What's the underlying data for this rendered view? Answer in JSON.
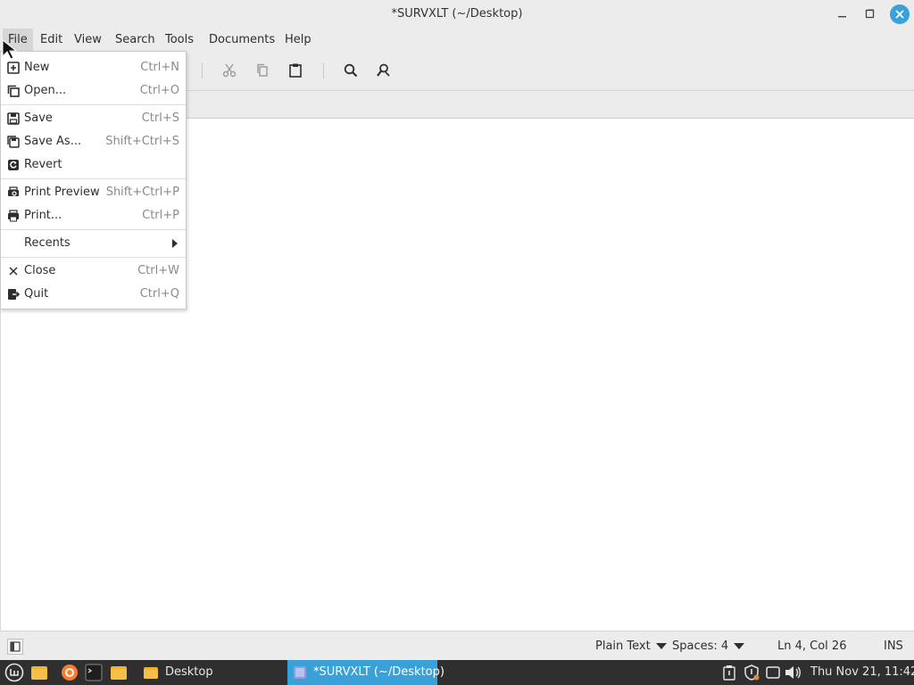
{
  "window": {
    "title": "*SURVXLT (~/Desktop)"
  },
  "menubar": {
    "items": [
      "File",
      "Edit",
      "View",
      "Search",
      "Tools",
      "Documents",
      "Help"
    ],
    "active": "File"
  },
  "toolbar": {
    "icons": [
      "cut-icon",
      "copy-icon",
      "paste-icon",
      "search-icon",
      "find-replace-icon"
    ]
  },
  "file_menu": {
    "items": [
      {
        "label": "New",
        "shortcut": "Ctrl+N",
        "icon": "new-document-icon"
      },
      {
        "label": "Open...",
        "shortcut": "Ctrl+O",
        "icon": "open-icon"
      },
      {
        "label": "Save",
        "shortcut": "Ctrl+S",
        "icon": "save-icon"
      },
      {
        "label": "Save As...",
        "shortcut": "Shift+Ctrl+S",
        "icon": "save-as-icon"
      },
      {
        "label": "Revert",
        "shortcut": "",
        "icon": "revert-icon"
      },
      {
        "label": "Print Preview",
        "shortcut": "Shift+Ctrl+P",
        "icon": "print-preview-icon"
      },
      {
        "label": "Print...",
        "shortcut": "Ctrl+P",
        "icon": "print-icon"
      },
      {
        "label": "Recents",
        "shortcut": "",
        "icon": ""
      },
      {
        "label": "Close",
        "shortcut": "Ctrl+W",
        "icon": "close-icon"
      },
      {
        "label": "Quit",
        "shortcut": "Ctrl+Q",
        "icon": "quit-icon"
      }
    ]
  },
  "statusbar": {
    "language": "Plain Text",
    "indent": "Spaces: 4",
    "position": "Ln 4, Col 26",
    "mode": "INS"
  },
  "taskbar": {
    "desktop_label": "Desktop",
    "active_window": "*SURVXLT (~/Desktop)",
    "clock": "Thu Nov 21, 11:42"
  },
  "colors": {
    "accent": "#3aa0d8",
    "panel": "#2f2f2f",
    "chrome": "#ececec"
  }
}
